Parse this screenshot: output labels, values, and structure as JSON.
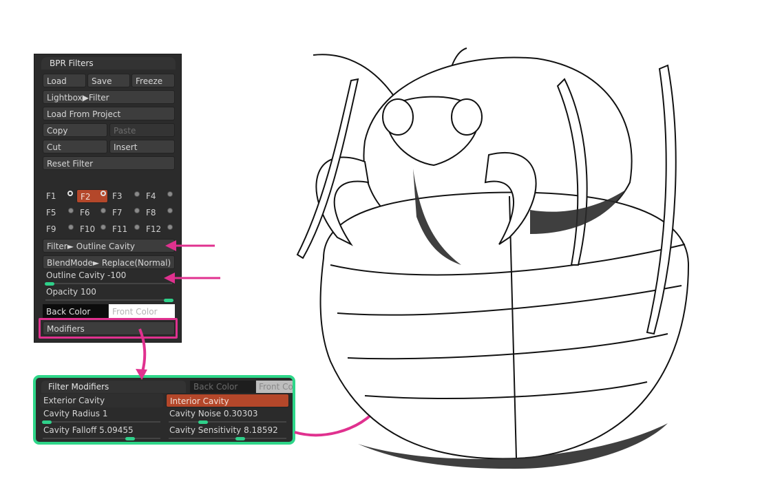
{
  "bpr_panel": {
    "title": "BPR Filters",
    "load": "Load",
    "save": "Save",
    "freeze": "Freeze",
    "lightbox_filter": "Lightbox▶Filter",
    "load_from_project": "Load From Project",
    "copy": "Copy",
    "paste": "Paste",
    "cut": "Cut",
    "insert": "Insert",
    "reset_filter": "Reset Filter",
    "filters": [
      "F1",
      "F2",
      "F3",
      "F4",
      "F5",
      "F6",
      "F7",
      "F8",
      "F9",
      "F10",
      "F11",
      "F12"
    ],
    "selected_filter": "F2",
    "filter_select": "Filter► Outline Cavity",
    "blendmode": "BlendMode► Replace(Normal)",
    "outline_label": "Outline Cavity",
    "outline_value": "-100",
    "opacity_label": "Opacity",
    "opacity_value": "100",
    "back_color": "Back Color",
    "front_color": "Front Color",
    "modifiers": "Modifiers"
  },
  "modifiers_panel": {
    "title": "Filter Modifiers",
    "back_color": "Back Color",
    "front_color": "Front Co",
    "exterior_cavity": "Exterior Cavity",
    "interior_cavity": "Interior Cavity",
    "cavity_radius_label": "Cavity Radius",
    "cavity_radius_value": "1",
    "cavity_noise_label": "Cavity Noise",
    "cavity_noise_value": "0.30303",
    "cavity_falloff_label": "Cavity Falloff",
    "cavity_falloff_value": "5.09455",
    "cavity_sensitivity_label": "Cavity Sensitivity",
    "cavity_sensitivity_value": "8.18592"
  },
  "colors": {
    "panel_bg": "#2b2b2b",
    "button_bg": "#3d3d3d",
    "active": "#b4472a",
    "slider_knob": "#2fd08a",
    "highlight_pink": "#e0318f",
    "highlight_green": "#2ed689"
  }
}
